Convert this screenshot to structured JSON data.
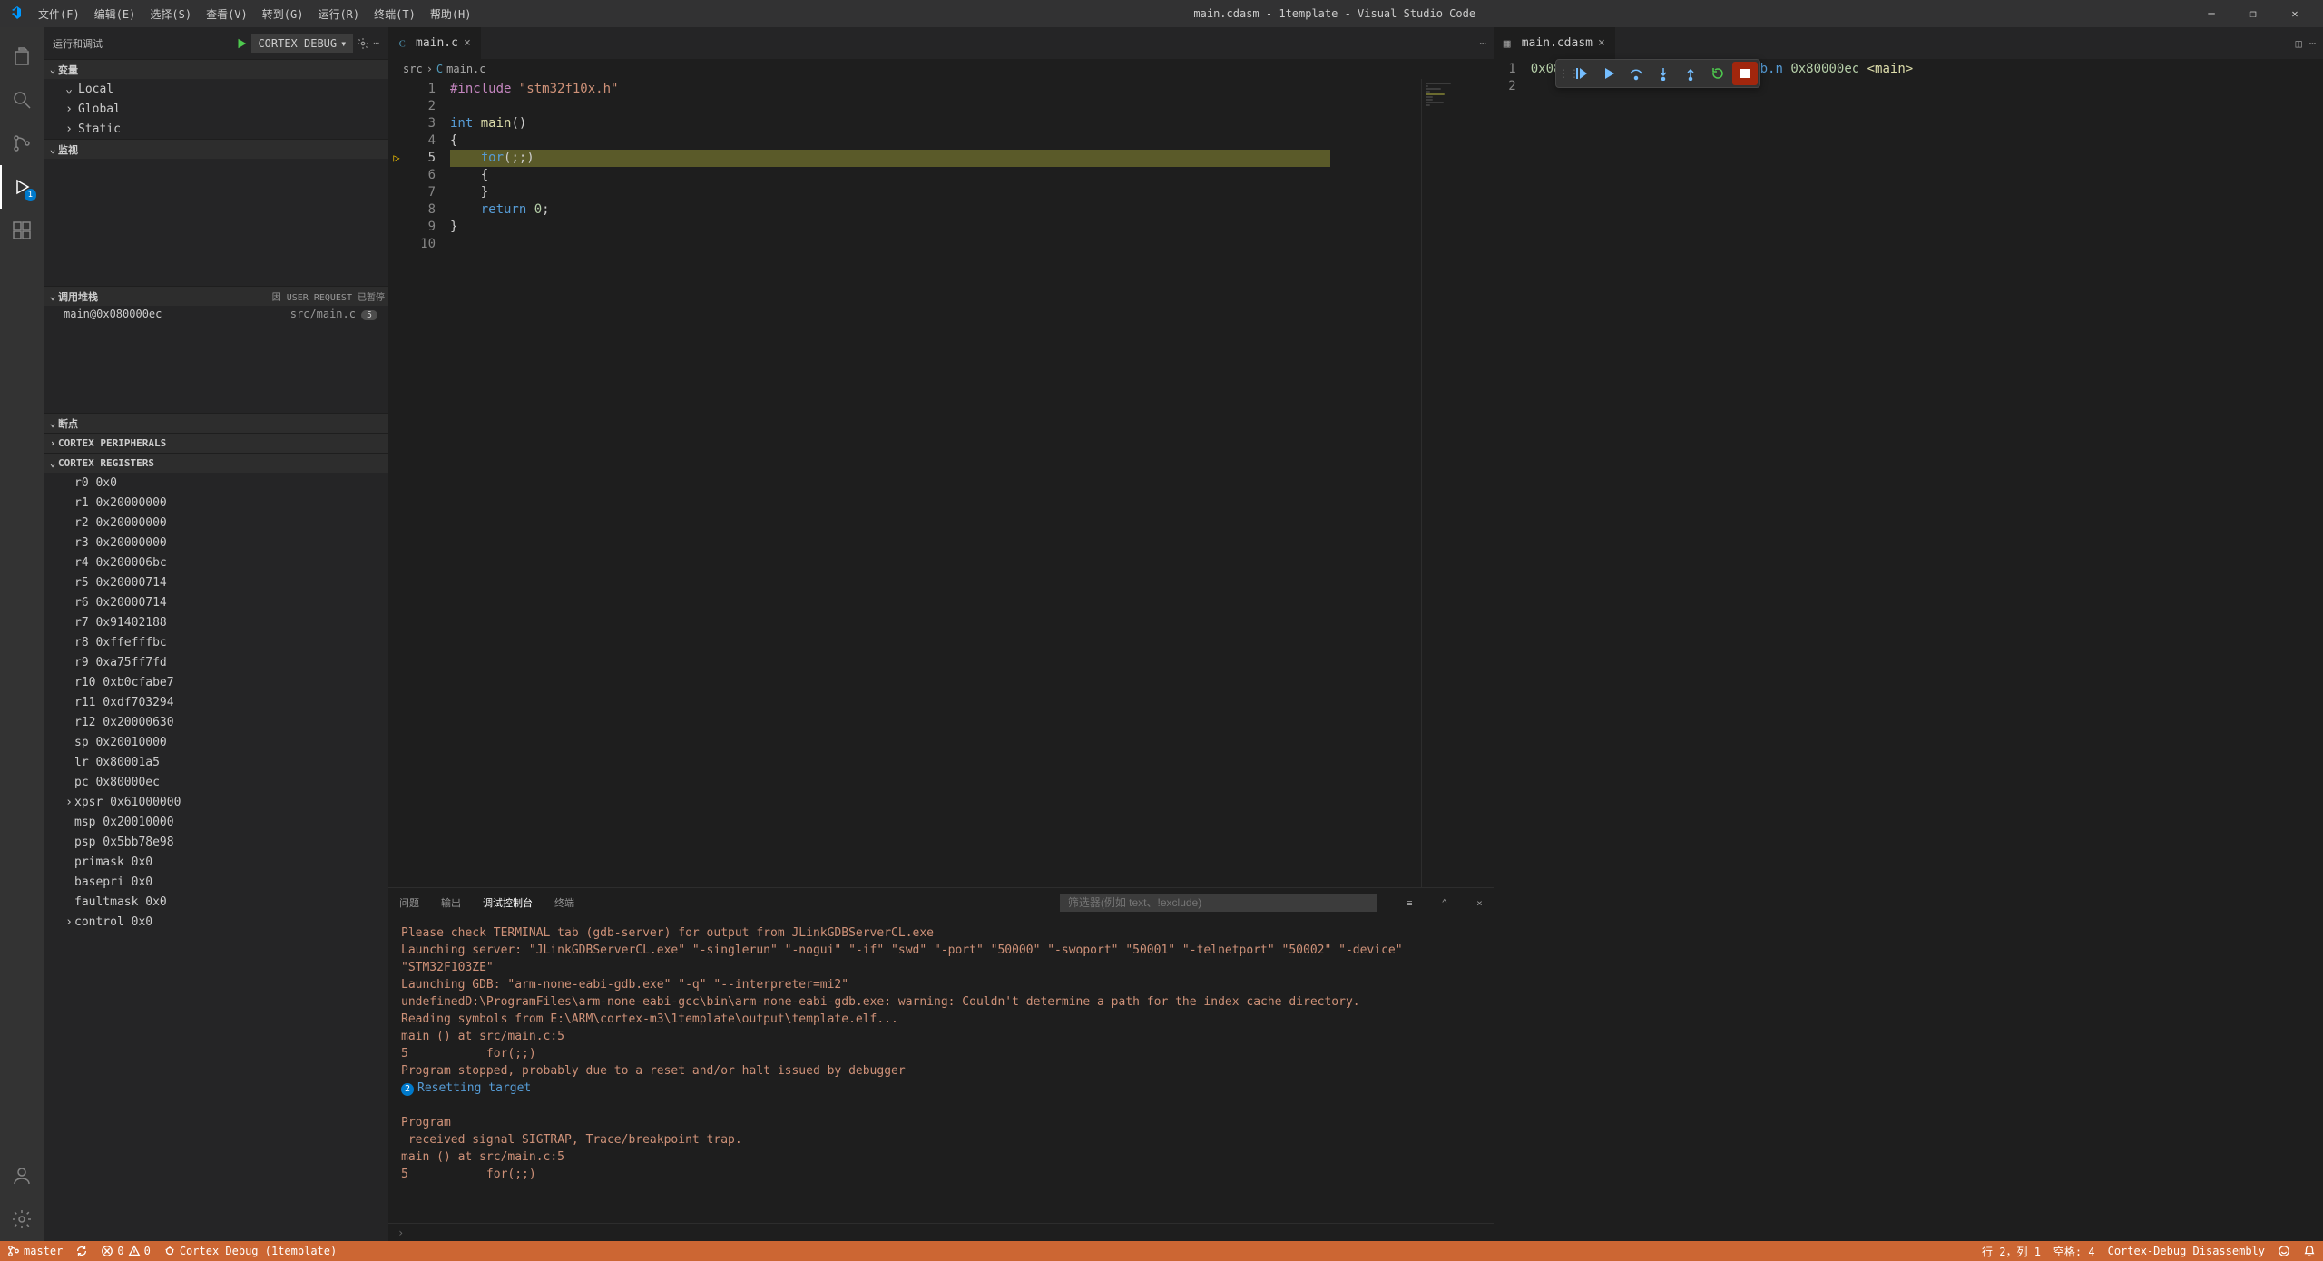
{
  "title": "main.cdasm - 1template - Visual Studio Code",
  "menu": [
    "文件(F)",
    "编辑(E)",
    "选择(S)",
    "查看(V)",
    "转到(G)",
    "运行(R)",
    "终端(T)",
    "帮助(H)"
  ],
  "sidebar_header": "运行和调试",
  "debug_config": "Cortex Debug",
  "sections": {
    "variables": "变量",
    "watch": "监视",
    "callstack": "调用堆栈",
    "callstack_note": "因 USER REQUEST 已暂停",
    "breakpoints": "断点",
    "cortex_peripherals": "CORTEX PERIPHERALS",
    "cortex_registers": "CORTEX REGISTERS"
  },
  "variables_scopes": [
    "Local",
    "Global",
    "Static"
  ],
  "callstack": {
    "frame": "main@0x080000ec",
    "file": "src/main.c",
    "badge": "5"
  },
  "registers": [
    {
      "n": "r0",
      "v": "0x0"
    },
    {
      "n": "r1",
      "v": "0x20000000"
    },
    {
      "n": "r2",
      "v": "0x20000000"
    },
    {
      "n": "r3",
      "v": "0x20000000"
    },
    {
      "n": "r4",
      "v": "0x200006bc"
    },
    {
      "n": "r5",
      "v": "0x20000714"
    },
    {
      "n": "r6",
      "v": "0x20000714"
    },
    {
      "n": "r7",
      "v": "0x91402188"
    },
    {
      "n": "r8",
      "v": "0xffefffbc"
    },
    {
      "n": "r9",
      "v": "0xa75ff7fd"
    },
    {
      "n": "r10",
      "v": "0xb0cfabe7"
    },
    {
      "n": "r11",
      "v": "0xdf703294"
    },
    {
      "n": "r12",
      "v": "0x20000630"
    },
    {
      "n": "sp",
      "v": "0x20010000"
    },
    {
      "n": "lr",
      "v": "0x80001a5"
    },
    {
      "n": "pc",
      "v": "0x80000ec"
    },
    {
      "n": "xpsr",
      "v": "0x61000000",
      "exp": true
    },
    {
      "n": "msp",
      "v": "0x20010000"
    },
    {
      "n": "psp",
      "v": "0x5bb78e98"
    },
    {
      "n": "primask",
      "v": "0x0"
    },
    {
      "n": "basepri",
      "v": "0x0"
    },
    {
      "n": "faultmask",
      "v": "0x0"
    },
    {
      "n": "control",
      "v": "0x0",
      "exp": true
    }
  ],
  "tabs": {
    "left": "main.c",
    "right": "main.cdasm"
  },
  "breadcrumbs": [
    "src",
    "main.c"
  ],
  "code": {
    "lines": [
      {
        "n": 1,
        "html": "<span class='pp'>#include</span> <span class='str'>\"stm32f10x.h\"</span>"
      },
      {
        "n": 2,
        "html": ""
      },
      {
        "n": 3,
        "html": "<span class='kw'>int</span> <span class='fn'>main</span>()"
      },
      {
        "n": 4,
        "html": "{"
      },
      {
        "n": 5,
        "html": "    <span class='kw'>for</span>(;;)",
        "current": true
      },
      {
        "n": 6,
        "html": "    {"
      },
      {
        "n": 7,
        "html": "    }"
      },
      {
        "n": 8,
        "html": "    <span class='kw'>return</span> <span class='num'>0</span>;"
      },
      {
        "n": 9,
        "html": "}"
      },
      {
        "n": 10,
        "html": ""
      }
    ]
  },
  "disasm": {
    "lines": [
      {
        "n": 1,
        "text": "0x080000ec: fe e7             b.n 0x80000ec <main>"
      },
      {
        "n": 2,
        "text": ""
      }
    ]
  },
  "terminal": {
    "tabs": [
      "问题",
      "输出",
      "调试控制台",
      "终端"
    ],
    "active_tab": 2,
    "filter_placeholder": "筛选器(例如 text、!exclude)",
    "lines": [
      "Please check TERMINAL tab (gdb-server) for output from JLinkGDBServerCL.exe",
      "Launching server: \"JLinkGDBServerCL.exe\" \"-singlerun\" \"-nogui\" \"-if\" \"swd\" \"-port\" \"50000\" \"-swoport\" \"50001\" \"-telnetport\" \"50002\" \"-device\" \"STM32F103ZE\"",
      "Launching GDB: \"arm-none-eabi-gdb.exe\" \"-q\" \"--interpreter=mi2\"",
      "undefinedD:\\ProgramFiles\\arm-none-eabi-gcc\\bin\\arm-none-eabi-gdb.exe: warning: Couldn't determine a path for the index cache directory.",
      "Reading symbols from E:\\ARM\\cortex-m3\\1template\\output\\template.elf...",
      "main () at src/main.c:5",
      "5           for(;;)",
      "Program stopped, probably due to a reset and/or halt issued by debugger"
    ],
    "reset_line": "Resetting target",
    "reset_badge": "2",
    "tail": [
      "",
      "Program",
      " received signal SIGTRAP, Trace/breakpoint trap.",
      "main () at src/main.c:5",
      "5           for(;;)"
    ]
  },
  "statusbar": {
    "branch": "master",
    "sync": "",
    "errors": "0",
    "warnings": "0",
    "debug_session": "Cortex Debug (1template)",
    "line_col": "行 2，列 1",
    "spaces": "空格: 4",
    "mode": "Cortex-Debug Disassembly",
    "feedback_icon": "",
    "bell_icon": ""
  }
}
